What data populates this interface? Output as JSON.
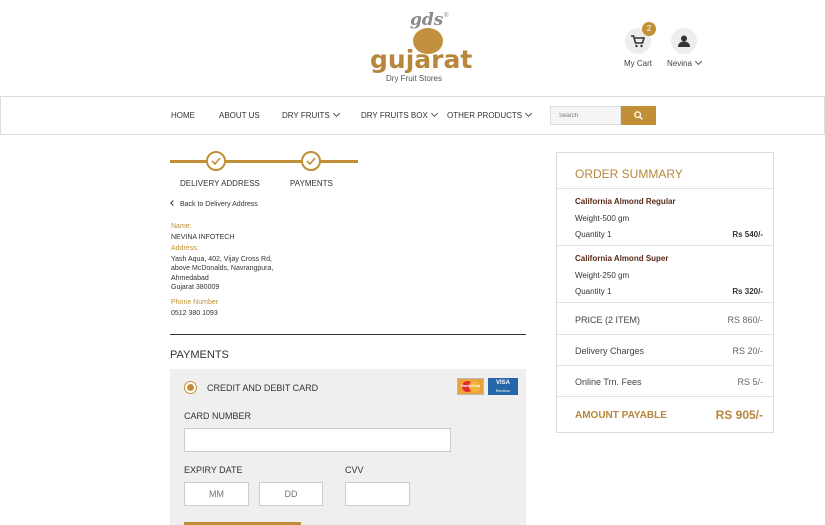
{
  "brand": {
    "gds": "gds",
    "tm": "®",
    "word": "gujarat",
    "sub": "Dry Fruit Stores"
  },
  "header": {
    "cart_label": "My Cart",
    "cart_count": "2",
    "user_label": "Nevina"
  },
  "nav": {
    "items": [
      "HOME",
      "ABOUT US",
      "DRY FRUITS",
      "DRY FRUITS BOX",
      "OTHER PRODUCTS"
    ],
    "search_placeholder": "Search"
  },
  "stepper": {
    "step1": "DELIVERY ADDRESS",
    "step2": "PAYMENTS"
  },
  "address": {
    "back_label": "Back to  Delivery Address",
    "name_label": "Name:",
    "name": "NEVINA INFOTECH",
    "address_label": "Address:",
    "lines": [
      "Yash Aqua, 402, Vijay Cross Rd,",
      "above McDonalds, Navrangpura,",
      "Ahmedabad",
      "Gujarat 380009"
    ],
    "phone_label": "Phone Number",
    "phone": "0512 380 1093"
  },
  "payments": {
    "title": "PAYMENTS",
    "method": "CREDIT AND DEBIT CARD",
    "mc_label": "MasterCard",
    "visa_label": "VISA",
    "visa_sub": "Electron",
    "card_number_label": "CARD NUMBER",
    "card_number_value": "",
    "expiry_label": "EXPIRY DATE",
    "mm_placeholder": "MM",
    "dd_placeholder": "DD",
    "cvv_label": "CVV",
    "cvv_value": ""
  },
  "summary": {
    "title": "ORDER SUMMARY",
    "items": [
      {
        "name": "California Almond Regular",
        "weight": "Weight-500 gm",
        "qty": "Quantity  1",
        "price": "Rs 540/-"
      },
      {
        "name": "California Almond Super",
        "weight": "Weight-250 gm",
        "qty": "Quantity  1",
        "price": "Rs 320/-"
      }
    ],
    "price_label": "PRICE (2 ITEM)",
    "price_value": "RS 860/-",
    "delivery_label": "Delivery Charges",
    "delivery_value": "RS 20/-",
    "fees_label": "Online Trn. Fees",
    "fees_value": "RS 5/-",
    "payable_label": "AMOUNT PAYABLE",
    "payable_value": "RS 905/-"
  },
  "colors": {
    "accent": "#c19036",
    "brown": "#5a2a18"
  }
}
